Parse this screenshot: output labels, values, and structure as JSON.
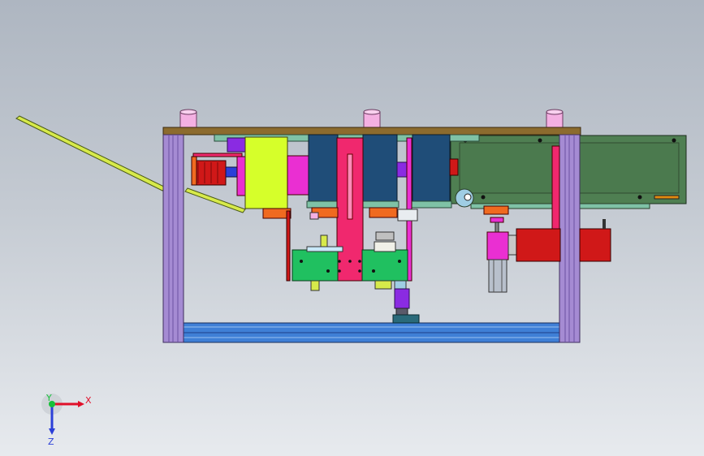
{
  "axes": {
    "x_label": "X",
    "y_label": "Y",
    "z_label": "Z",
    "x_color": "#e0102a",
    "y_color": "#16c03a",
    "z_color": "#2b3fd8"
  },
  "colors": {
    "frame_purple": "#a58bd3",
    "top_plate": "#8c6b2e",
    "base_rail": "#3f7fd6",
    "pink": "#f0286e",
    "magenta": "#ea2fd2",
    "navy": "#1f4d78",
    "green_board": "#4f7f52",
    "bright_green": "#20c060",
    "lime": "#d6ff2a",
    "red": "#d01818",
    "orange": "#f06a20",
    "violet": "#8a2be2",
    "yellow_rail": "#d7ea4a",
    "cylinder_pink": "#f4b0e2",
    "teal": "#7fc2a6"
  }
}
